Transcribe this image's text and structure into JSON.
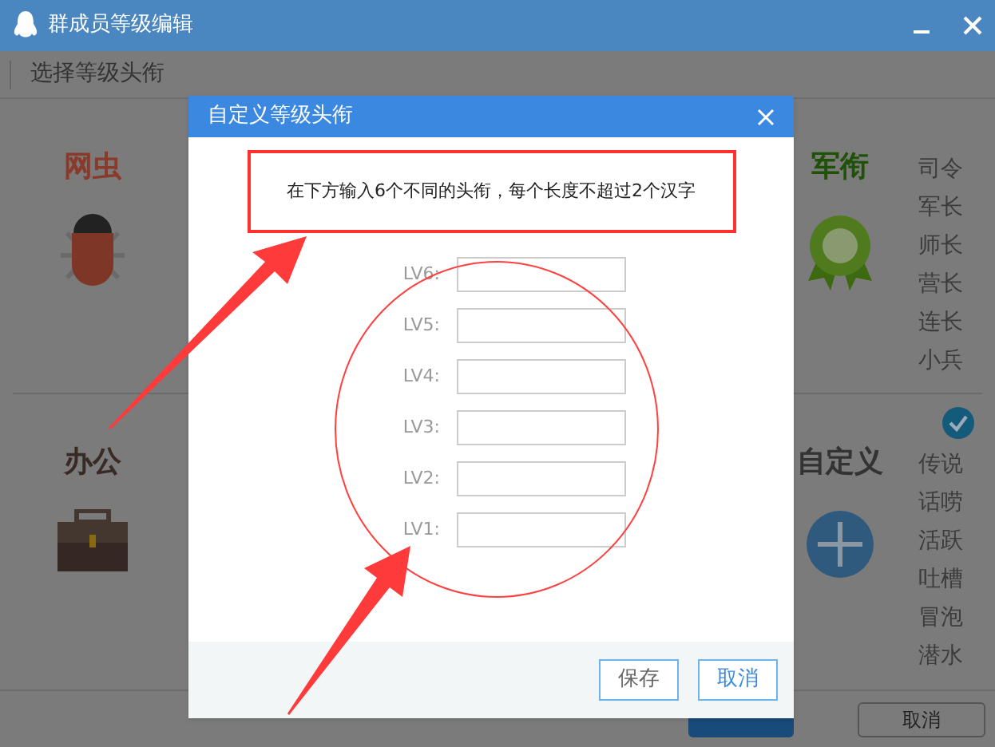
{
  "window": {
    "title": "群成员等级编辑"
  },
  "toolbar": {
    "label": "选择等级头衔"
  },
  "categories": [
    {
      "name": "网虫",
      "color": "#8a3a2a",
      "kind": "bug",
      "selected": false
    },
    {
      "name": "军衔",
      "color": "#1f5208",
      "kind": "medal",
      "selected": false,
      "titles": [
        "司令",
        "军长",
        "师长",
        "营长",
        "连长",
        "小兵"
      ]
    },
    {
      "name": "办公",
      "color": "#3a2a26",
      "kind": "briefcase",
      "selected": false
    },
    {
      "name": "自定义",
      "color": "#333333",
      "kind": "plus",
      "selected": true,
      "titles": [
        "传说",
        "话唠",
        "活跃",
        "吐槽",
        "冒泡",
        "潜水"
      ]
    }
  ],
  "footer_buttons": [
    {
      "kind": "primary"
    },
    {
      "kind": "default",
      "label": "取消"
    }
  ],
  "dialog": {
    "title": "自定义等级头衔",
    "instruction": "在下方输入6个不同的头衔，每个长度不超过2个汉字",
    "fields": [
      {
        "label": "LV6:"
      },
      {
        "label": "LV5:"
      },
      {
        "label": "LV4:"
      },
      {
        "label": "LV3:"
      },
      {
        "label": "LV2:"
      },
      {
        "label": "LV1:"
      }
    ],
    "buttons": [
      "保存",
      "取消"
    ]
  }
}
